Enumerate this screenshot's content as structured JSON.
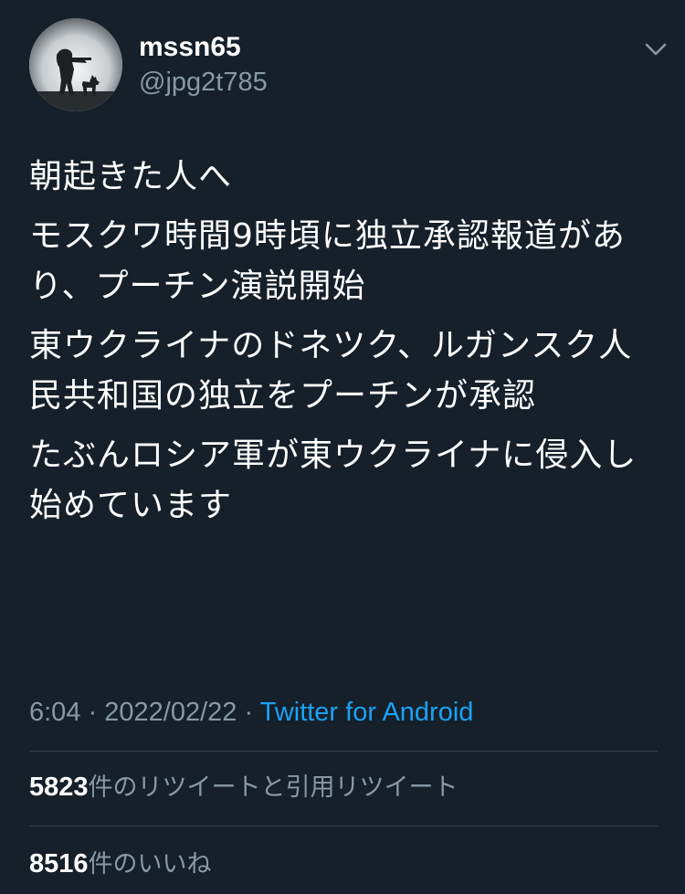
{
  "user": {
    "display_name": "mssn65",
    "handle": "@jpg2t785",
    "avatar_icon": "soldier-with-dog-silhouette"
  },
  "tweet": {
    "paragraphs": [
      "朝起きた人へ",
      "モスクワ時間9時頃に独立承認報道があり、プーチン演説開始",
      "東ウクライナのドネツク、ルガンスク人民共和国の独立をプーチンが承認",
      "たぶんロシア軍が東ウクライナに侵入し始めています"
    ]
  },
  "meta": {
    "time": "6:04",
    "separator": "·",
    "date": "2022/02/22",
    "source": "Twitter for Android"
  },
  "stats": {
    "retweets_count": "5823",
    "retweets_label": "件のリツイートと引用リツイート",
    "likes_count": "8516",
    "likes_label": "件のいいね"
  },
  "colors": {
    "background": "#15202b",
    "secondary_text": "#8899a6",
    "link": "#1da1f2",
    "divider": "#38444d"
  }
}
